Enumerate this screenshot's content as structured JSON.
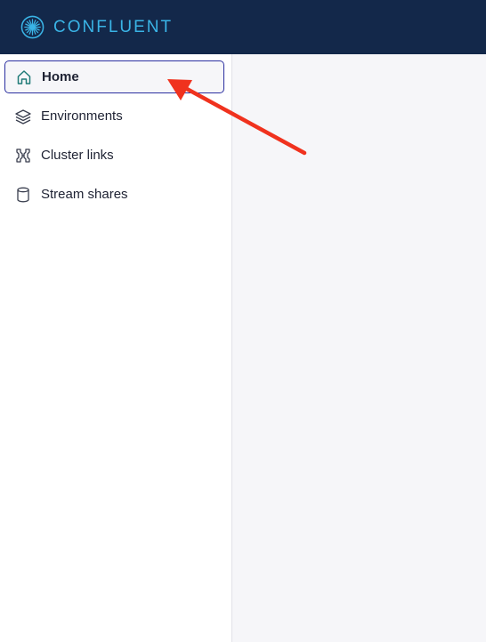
{
  "brand": {
    "name": "CONFLUENT",
    "color": "#3ab4e6",
    "header_bg": "#13284a"
  },
  "sidebar": {
    "items": [
      {
        "label": "Home",
        "icon": "home-icon",
        "active": true
      },
      {
        "label": "Environments",
        "icon": "layers-icon",
        "active": false
      },
      {
        "label": "Cluster links",
        "icon": "cluster-links-icon",
        "active": false
      },
      {
        "label": "Stream shares",
        "icon": "database-icon",
        "active": false
      }
    ]
  },
  "annotation": {
    "type": "arrow",
    "color": "#f0321e",
    "target": "Home"
  }
}
